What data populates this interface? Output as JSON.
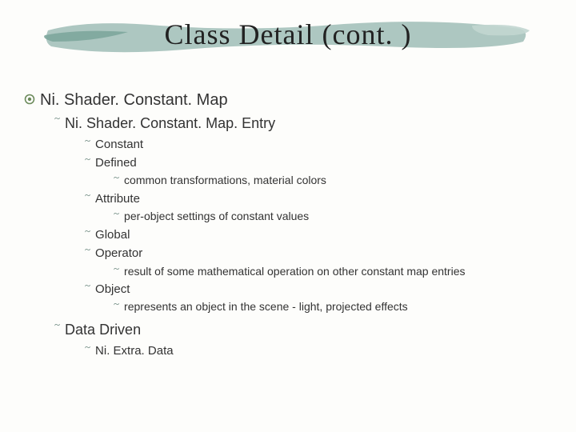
{
  "title": "Class Detail (cont. )",
  "items": {
    "l0": "Ni. Shader. Constant. Map",
    "l1": "Ni. Shader. Constant. Map. Entry",
    "l2_constant": "Constant",
    "l2_defined": "Defined",
    "l3_defined_note": "common transformations, material colors",
    "l2_attribute": "Attribute",
    "l3_attribute_note": "per-object settings of constant values",
    "l2_global": "Global",
    "l2_operator": "Operator",
    "l3_operator_note": "result of some mathematical operation on other constant map entries",
    "l2_object": "Object",
    "l3_object_note": "represents an object in the scene - light, projected effects",
    "l1_datadriven": "Data Driven",
    "l2_niextra": "Ni. Extra. Data"
  }
}
